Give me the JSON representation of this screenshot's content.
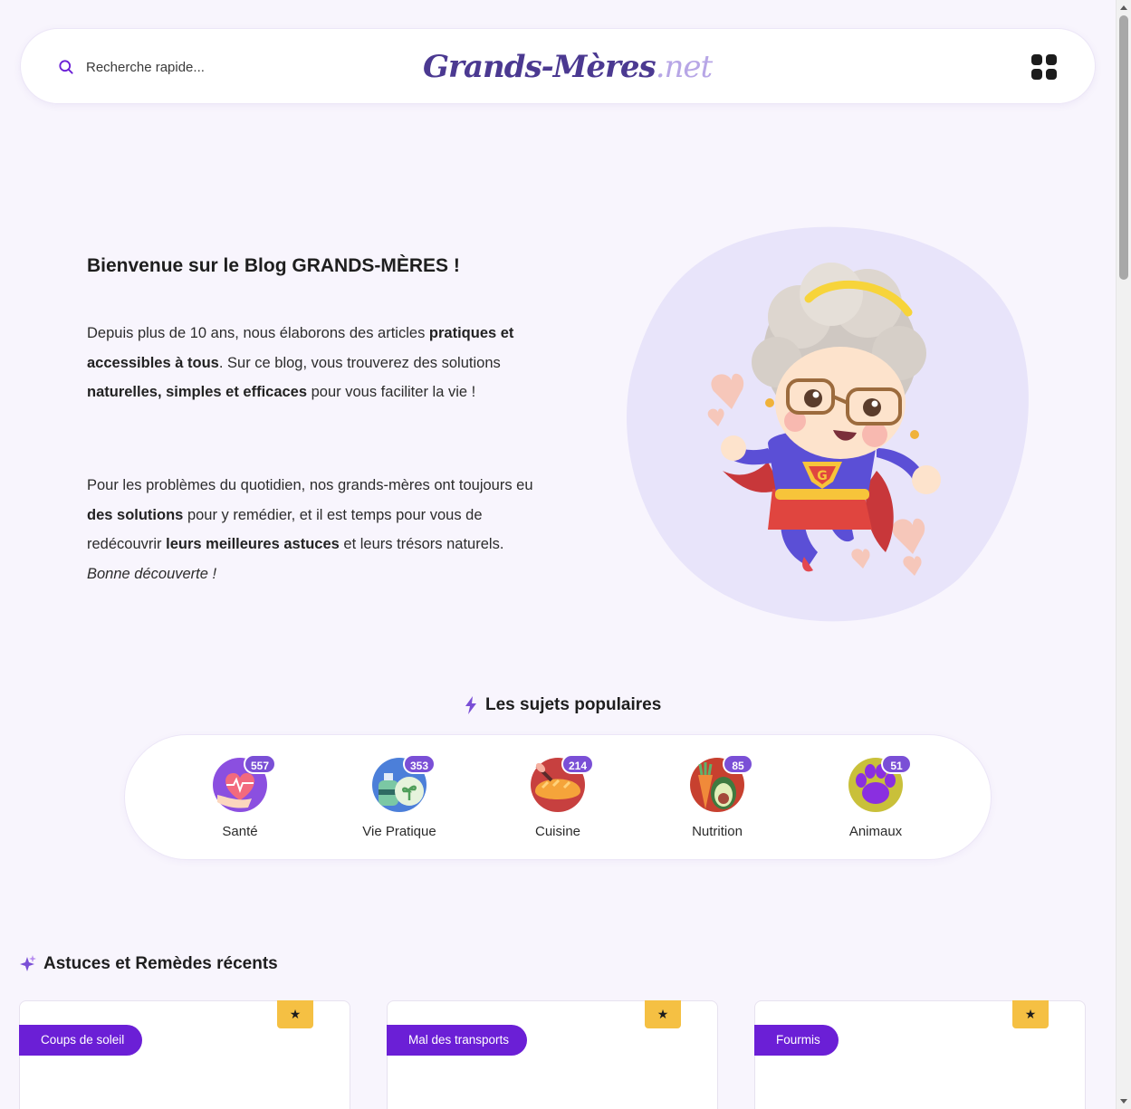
{
  "header": {
    "search_placeholder": "Recherche rapide...",
    "logo_brand": "Grands-Mères",
    "logo_tld": ".net",
    "menu_icon": "grid-icon"
  },
  "hero": {
    "title_prefix": "Bienvenue sur le Blog ",
    "title_bold": "GRANDS-MÈRES",
    "title_suffix": " !",
    "p1": [
      {
        "t": "Depuis plus de 10 ans, nous élaborons des articles ",
        "s": "n"
      },
      {
        "t": "pratiques et accessibles à tous",
        "s": "b"
      },
      {
        "t": ". Sur ce blog, vous trouverez des solutions ",
        "s": "n"
      },
      {
        "t": "naturelles, simples et efficaces",
        "s": "b"
      },
      {
        "t": " pour vous faciliter la vie !",
        "s": "n"
      }
    ],
    "p2": [
      {
        "t": "Pour les problèmes du quotidien, nos grands-mères ont toujours eu ",
        "s": "n"
      },
      {
        "t": "des solutions",
        "s": "b"
      },
      {
        "t": " pour y remédier, et il est temps pour vous de redécouvrir ",
        "s": "n"
      },
      {
        "t": "leurs meilleures astuces",
        "s": "b"
      },
      {
        "t": " et leurs trésors naturels. ",
        "s": "n"
      },
      {
        "t": "Bonne découverte !",
        "s": "i"
      }
    ]
  },
  "popular": {
    "title": "Les sujets populaires",
    "topics": [
      {
        "label": "Santé",
        "count": "557",
        "icon": "heart-pulse-icon"
      },
      {
        "label": "Vie Pratique",
        "count": "353",
        "icon": "spray-plant-icon"
      },
      {
        "label": "Cuisine",
        "count": "214",
        "icon": "bread-whisk-icon"
      },
      {
        "label": "Nutrition",
        "count": "85",
        "icon": "avocado-carrot-icon"
      },
      {
        "label": "Animaux",
        "count": "51",
        "icon": "paw-icon"
      }
    ]
  },
  "recent": {
    "title": "Astuces et Remèdes récents",
    "articles": [
      {
        "tag": "Coups de soleil",
        "star": "★"
      },
      {
        "tag": "Mal des transports",
        "star": "★"
      },
      {
        "tag": "Fourmis",
        "star": "★"
      }
    ]
  },
  "colors": {
    "accent": "#6b1fd6",
    "badge": "#7a4fd6",
    "logo": "#4b3991",
    "star": "#f5c043",
    "background": "#f8f5fd"
  }
}
